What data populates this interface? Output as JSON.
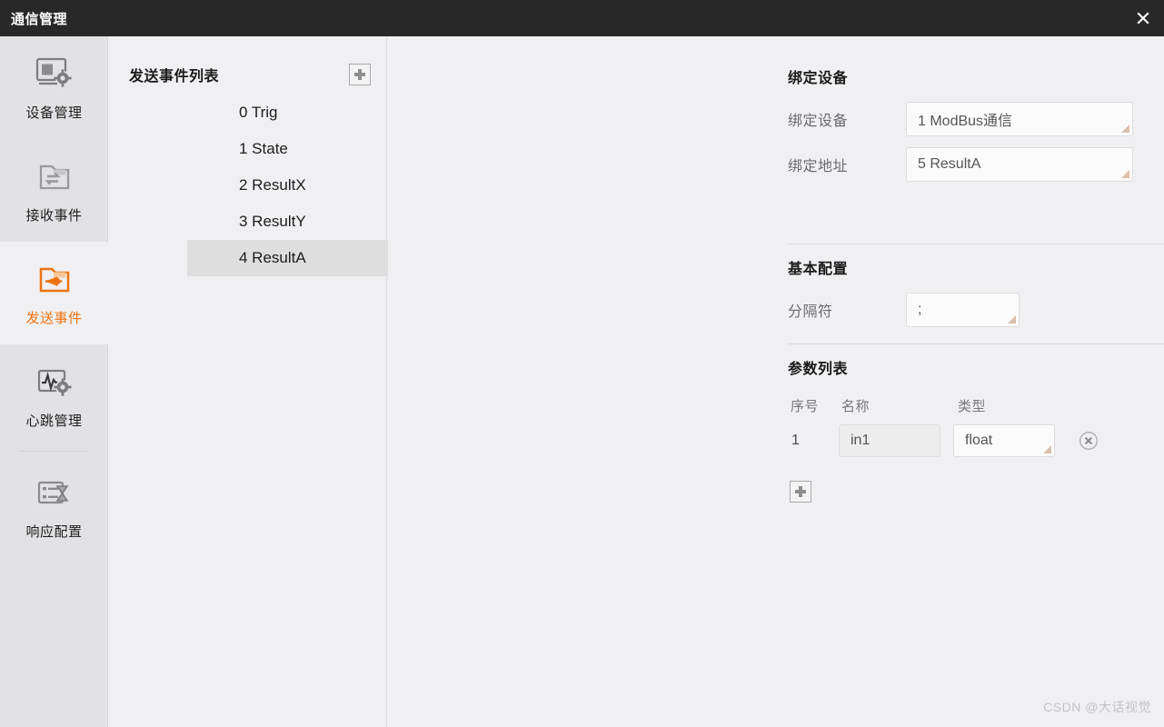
{
  "window": {
    "title": "通信管理",
    "close_icon": "close-icon",
    "titlebar_bg": "#282828",
    "accent": "#ee7310"
  },
  "sidebar": {
    "items": [
      {
        "label": "设备管理",
        "icon": "monitor-gear-icon",
        "active": false
      },
      {
        "label": "接收事件",
        "icon": "folder-in-icon",
        "active": false
      },
      {
        "label": "发送事件",
        "icon": "folder-out-icon",
        "active": true
      },
      {
        "label": "心跳管理",
        "icon": "pulse-gear-icon",
        "active": false
      },
      {
        "label": "响应配置",
        "icon": "list-hourglass-icon",
        "active": false
      }
    ],
    "divider_after_index": 3
  },
  "event_list": {
    "title": "发送事件列表",
    "add_icon": "plus-icon",
    "add_label": "+",
    "items": [
      {
        "label": "0 Trig",
        "selected": false
      },
      {
        "label": "1 State",
        "selected": false
      },
      {
        "label": "2 ResultX",
        "selected": false
      },
      {
        "label": "3 ResultY",
        "selected": false
      },
      {
        "label": "4 ResultA",
        "selected": true
      }
    ]
  },
  "detail": {
    "bind_section": {
      "title": "绑定设备",
      "fields": [
        {
          "label": "绑定设备",
          "value": "1 ModBus通信",
          "type": "combobox"
        },
        {
          "label": "绑定地址",
          "value": "5 ResultA",
          "type": "combobox"
        }
      ]
    },
    "basic_section": {
      "title": "基本配置",
      "fields": [
        {
          "label": "分隔符",
          "value": ";",
          "type": "combobox"
        }
      ]
    },
    "param_section": {
      "title": "参数列表",
      "columns": [
        "序号",
        "名称",
        "类型"
      ],
      "rows": [
        {
          "index": "1",
          "name": "in1",
          "type": "float",
          "delete_icon": "circle-x-icon"
        }
      ],
      "add_icon": "plus-icon",
      "add_label": "+"
    }
  },
  "watermark": "CSDN @大话视觉"
}
